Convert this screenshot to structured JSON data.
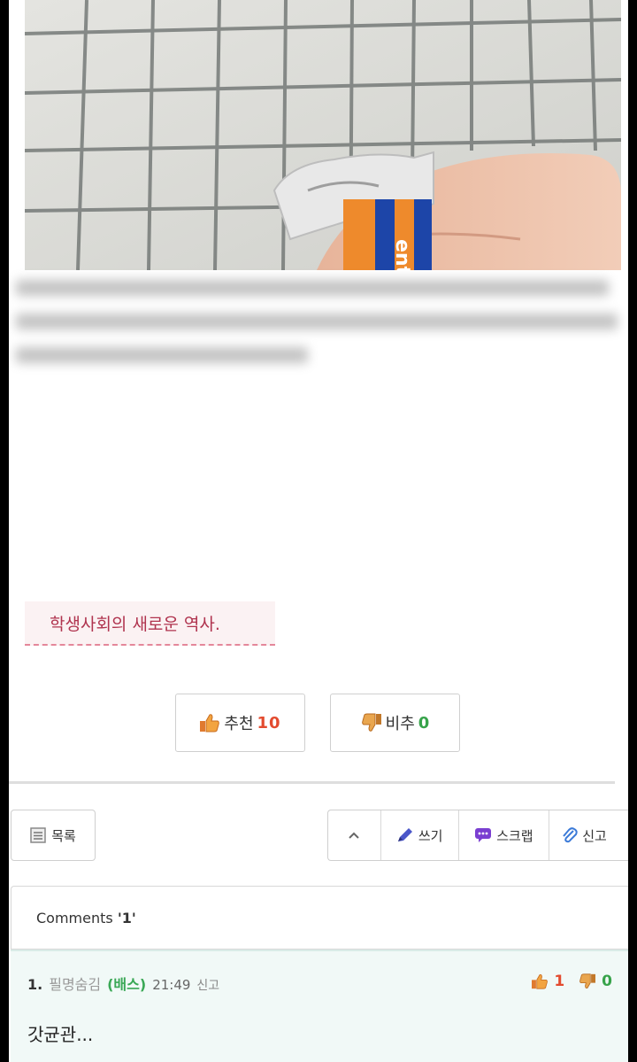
{
  "post": {
    "caption": "학생사회의 새로운 역사."
  },
  "votes": {
    "recommend_label": "추천",
    "recommend_count": "10",
    "disrecommend_label": "비추",
    "disrecommend_count": "0"
  },
  "toolbar": {
    "list_label": "목록",
    "write_label": "쓰기",
    "scrap_label": "스크랩",
    "report_label": "신고"
  },
  "comments": {
    "header_prefix": "Comments ",
    "count": "'1'",
    "items": [
      {
        "number": "1.",
        "author": "필명숨김",
        "nickname": "(배스)",
        "time": "21:49",
        "report_label": "신고",
        "up_count": "1",
        "down_count": "0",
        "body": "갓균관..."
      }
    ]
  },
  "colors": {
    "caption_text": "#b0344f",
    "recommend_count": "#e34b2f",
    "disrecommend_count": "#37a34a",
    "comment_bg": "#f1f9f7"
  }
}
